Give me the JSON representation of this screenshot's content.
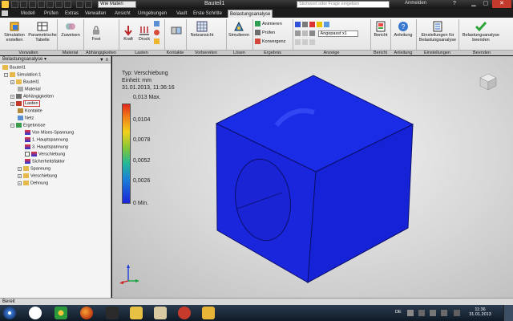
{
  "window": {
    "title": "Bauteil1",
    "material_value": "Wie Materi",
    "search_placeholder": "Stichwort oder Frage eingeben",
    "signin_label": "Anmelden",
    "help_label": "?"
  },
  "ribbon_tabs": [
    "Modell",
    "Prüfen",
    "Extras",
    "Verwalten",
    "Ansicht",
    "Umgebungen",
    "Vault",
    "Erste Schritte",
    "Belastungsanalyse"
  ],
  "active_tab": "Belastungsanalyse",
  "ribbon": {
    "sim_create": "Simulation erstellen",
    "param_table": "Parametrische Tabelle",
    "assign": "Zuweisen",
    "fixed": "Fest",
    "force": "Kraft",
    "pressure": "Druck",
    "mesh_view": "Netzansicht",
    "simulate": "Simulieren",
    "animate": "Animieren",
    "check": "Prüfen",
    "convergence": "Konvergenz",
    "scale_value": "Angepasst x1",
    "report": "Bericht",
    "guide": "Anleitung",
    "settings": "Einstellungen für Belastungsanalyse",
    "finish": "Belastungsanalyse beenden"
  },
  "panels": [
    "Verwalten",
    "Material",
    "Abhängigkeiten",
    "Lasten",
    "Kontakte",
    "Vorbereiten",
    "Lösen",
    "Ergebnis",
    "Anzeige",
    "Bericht",
    "Anleitung",
    "Einstellungen",
    "Beenden"
  ],
  "browser": {
    "title": "Belastungsanalyse",
    "nodes": [
      {
        "label": "Bauteil1",
        "depth": 0
      },
      {
        "label": "Simulation:1",
        "depth": 1
      },
      {
        "label": "Bauteil1",
        "depth": 2
      },
      {
        "label": "Material",
        "depth": 2
      },
      {
        "label": "Abhängigkeiten",
        "depth": 2
      },
      {
        "label": "Lasten",
        "depth": 2
      },
      {
        "label": "Kontakte",
        "depth": 2
      },
      {
        "label": "Netz",
        "depth": 2
      },
      {
        "label": "Ergebnisse",
        "depth": 2
      },
      {
        "label": "Von Mises-Spannung",
        "depth": 3
      },
      {
        "label": "1. Hauptspannung",
        "depth": 3
      },
      {
        "label": "3. Hauptspannung",
        "depth": 3
      },
      {
        "label": "Verschiebung",
        "depth": 3
      },
      {
        "label": "Sicherheitsfaktor",
        "depth": 3
      },
      {
        "label": "Spannung",
        "depth": 3
      },
      {
        "label": "Verschiebung",
        "depth": 3
      },
      {
        "label": "Dehnung",
        "depth": 3
      }
    ]
  },
  "legend": {
    "type_line": "Typ: Verschiebung",
    "unit_line": "Einheit: mm",
    "date_line": "31.01.2013, 11:36:16",
    "max_label": "0,013 Max.",
    "ticks": [
      "0,0104",
      "0,0078",
      "0,0052",
      "0,0026",
      "0 Min."
    ]
  },
  "status": "Bereit",
  "taskbar": {
    "language": "DE",
    "time": "11:36",
    "date": "31.01.2013"
  }
}
